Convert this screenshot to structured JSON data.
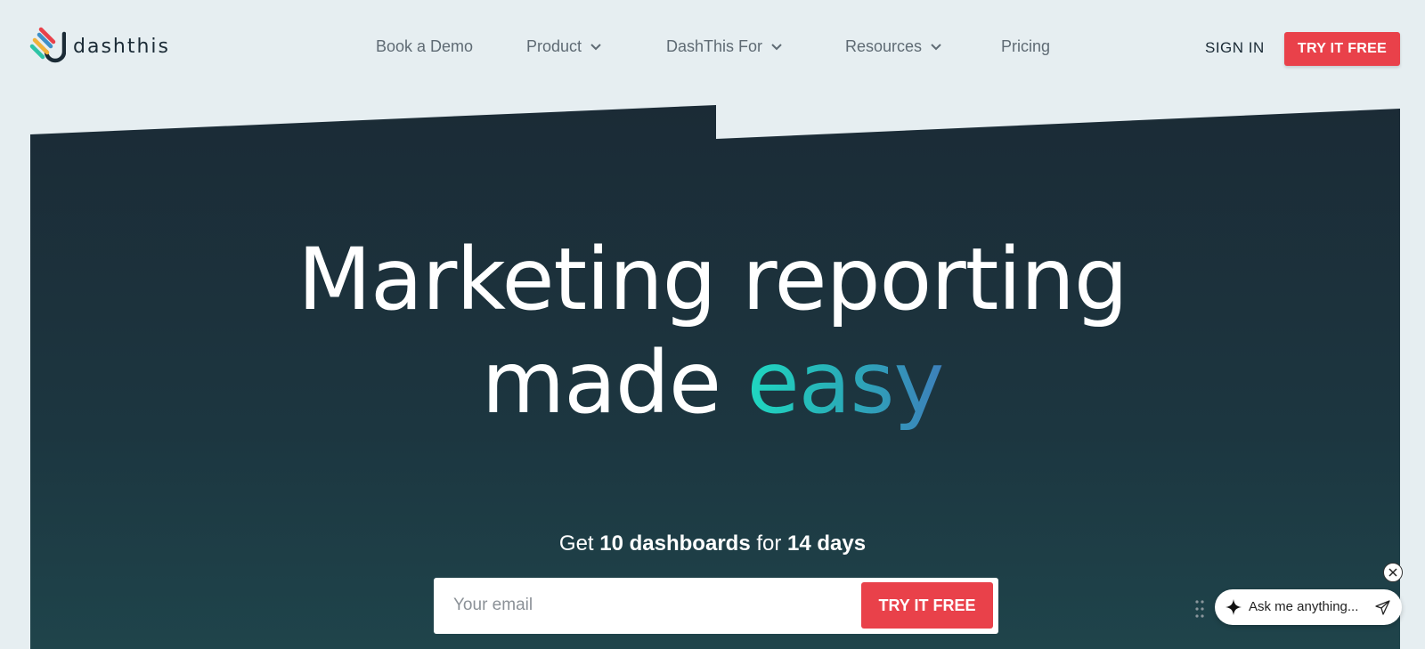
{
  "logo": {
    "text": "dashthis"
  },
  "nav": {
    "items": [
      {
        "label": "Book a Demo",
        "has_dropdown": false
      },
      {
        "label": "Product",
        "has_dropdown": true
      },
      {
        "label": "DashThis For",
        "has_dropdown": true
      },
      {
        "label": "Resources",
        "has_dropdown": true
      },
      {
        "label": "Pricing",
        "has_dropdown": false
      }
    ],
    "sign_in": "SIGN IN",
    "try_free": "TRY IT FREE"
  },
  "hero": {
    "line1": "Marketing reporting",
    "line2_prefix": "made ",
    "line2_accent": "easy",
    "subhead": {
      "part1": "Get ",
      "bold1": "10 dashboards",
      "part2": " for ",
      "bold2": "14 days"
    },
    "email_placeholder": "Your email",
    "cta": "TRY IT FREE"
  },
  "chat": {
    "prompt": "Ask me anything..."
  },
  "colors": {
    "page_bg": "#e6eef1",
    "hero_bg_top": "#1b2b36",
    "hero_bg_bottom": "#1f444b",
    "cta_red": "#e9414a",
    "accent_start": "#1fd8c1",
    "accent_end": "#3d7fba"
  },
  "icons": {
    "logo": "dashthis-logo-icon",
    "dropdown": "chevron-down-icon",
    "chat_spark": "sparkle-icon",
    "chat_send": "send-icon",
    "chat_close": "close-icon",
    "chat_drag": "drag-handle-icon"
  }
}
